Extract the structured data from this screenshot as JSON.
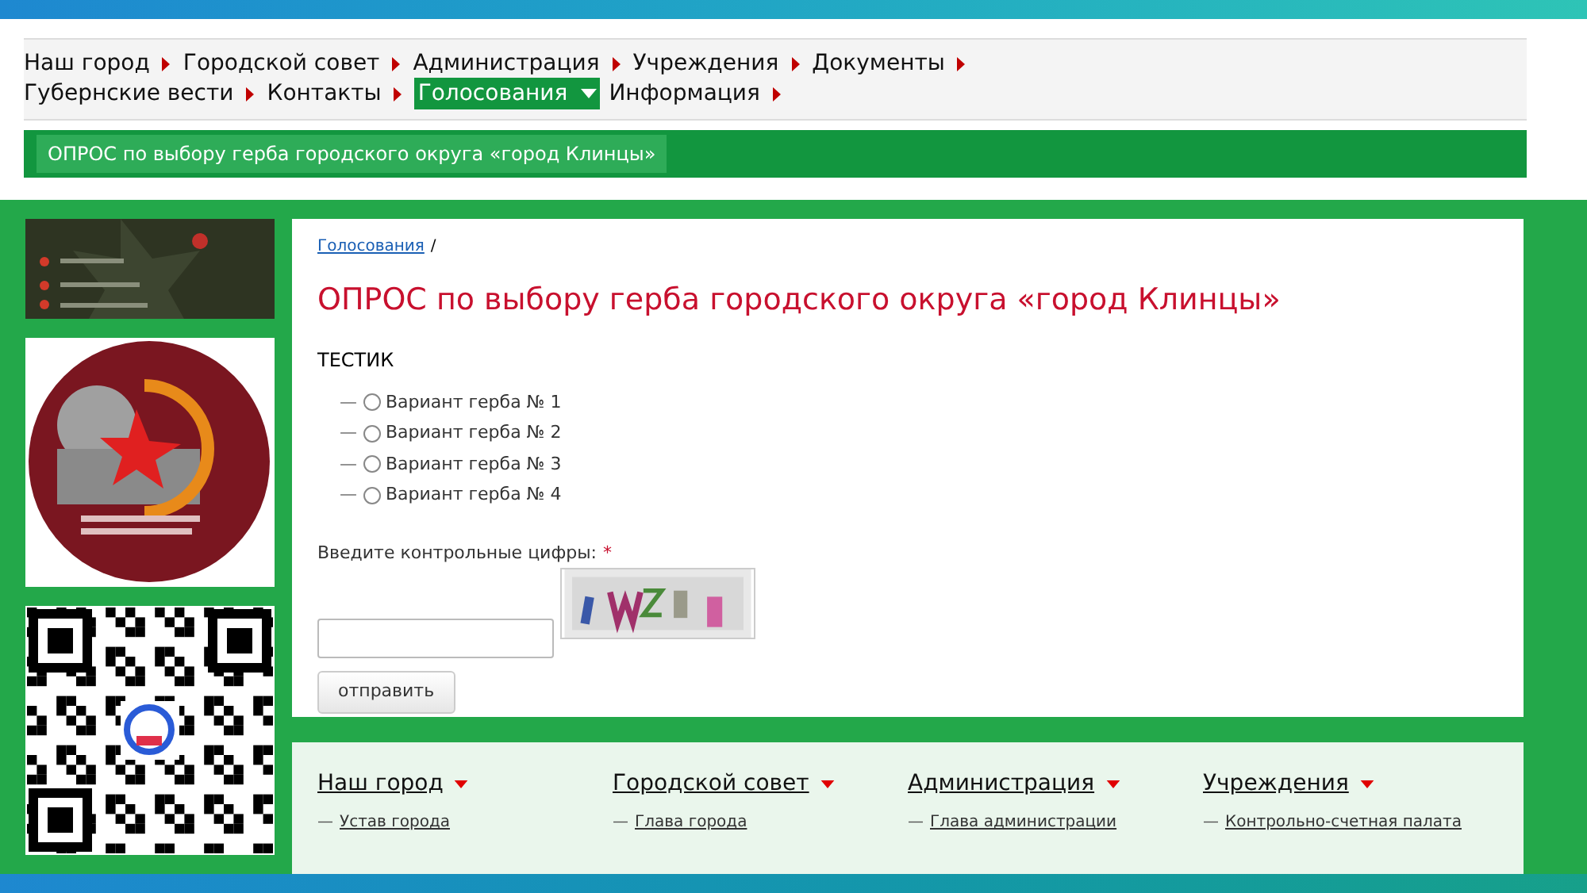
{
  "nav": {
    "items": [
      {
        "label": "Наш город",
        "selected": false
      },
      {
        "label": "Городской совет",
        "selected": false
      },
      {
        "label": "Администрация",
        "selected": false
      },
      {
        "label": "Учреждения",
        "selected": false
      },
      {
        "label": "Документы",
        "selected": false
      },
      {
        "label": "Губернские вести",
        "selected": false
      },
      {
        "label": "Контакты",
        "selected": false
      },
      {
        "label": "Голосования",
        "selected": true
      },
      {
        "label": "Информация",
        "selected": false
      }
    ]
  },
  "subnav": {
    "item": "ОПРОС по выбору герба городского округа «город Клинцы»"
  },
  "content": {
    "breadcrumb": {
      "link": "Голосования",
      "separator": "/"
    },
    "title": "ОПРОС по выбору герба городского округа «город Клинцы»",
    "question": "ТЕСТИК",
    "option_marker": "—",
    "options": [
      {
        "label": "Вариант герба № 1",
        "selected": false
      },
      {
        "label": "Вариант герба № 2",
        "selected": false
      },
      {
        "label": "Вариант герба № 3",
        "selected": false
      },
      {
        "label": "Вариант герба № 4",
        "selected": false
      }
    ],
    "captcha_label": "Введите контрольные цифры:",
    "required_mark": "*",
    "submit": "отправить"
  },
  "footer": {
    "link_marker": "—",
    "columns": [
      {
        "heading": "Наш город",
        "link": "Устав города"
      },
      {
        "heading": "Городской совет",
        "link": "Глава города"
      },
      {
        "heading": "Администрация",
        "link": "Глава администрации"
      },
      {
        "heading": "Учреждения",
        "link": "Контрольно-счетная палата"
      }
    ]
  }
}
